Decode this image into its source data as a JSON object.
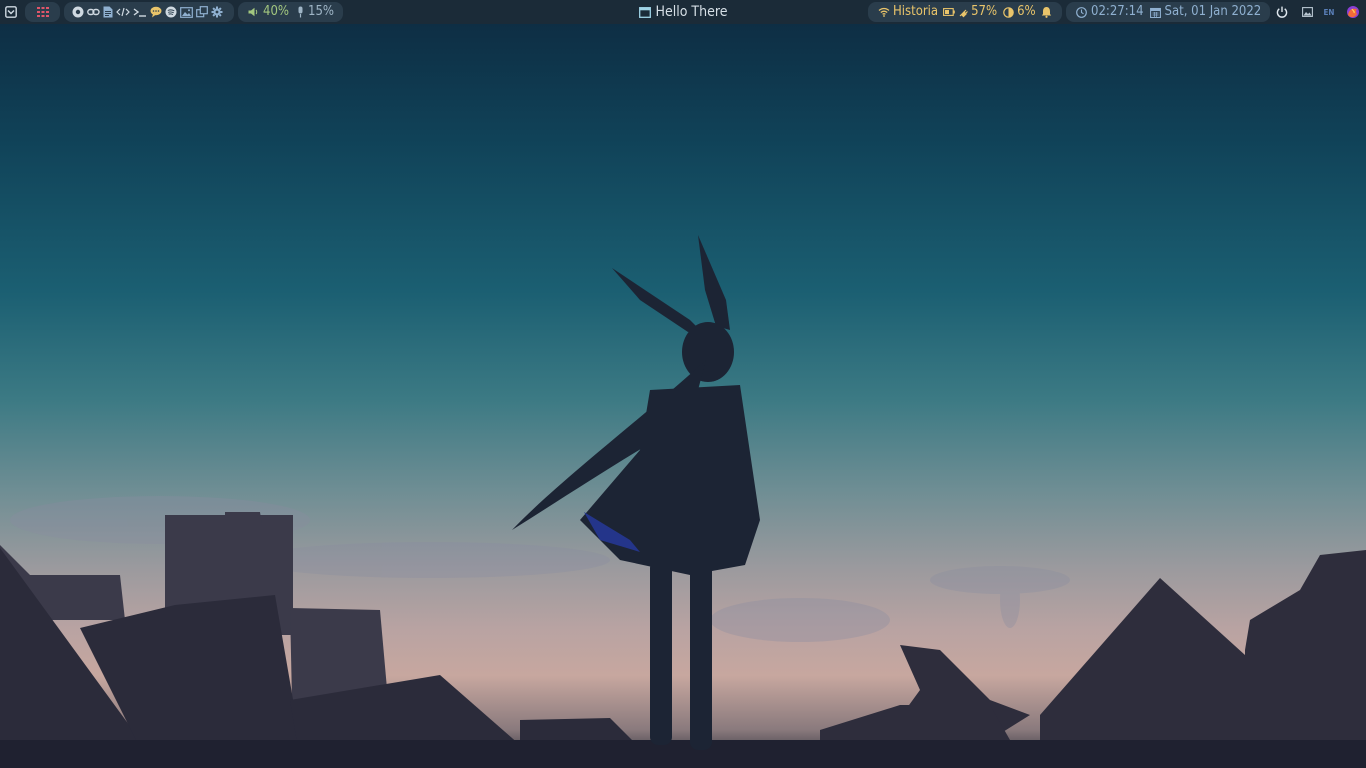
{
  "colors": {
    "bar_bg": "#1b2b38",
    "pill_bg": "#2a3d4c",
    "text": "#9fb5c6",
    "accent_red": "#e0566a",
    "accent_yellow": "#e9c46a",
    "accent_cyan": "#7fb8d4"
  },
  "topbar": {
    "menu_icon": "dropdown-box-icon",
    "apps_icon": "grid-icon",
    "launchers": [
      {
        "icon": "chrome-icon"
      },
      {
        "icon": "link-icon"
      },
      {
        "icon": "document-icon"
      },
      {
        "icon": "code-icon"
      },
      {
        "icon": "terminal-icon"
      },
      {
        "icon": "chat-icon"
      },
      {
        "icon": "spotify-icon"
      },
      {
        "icon": "image-icon"
      },
      {
        "icon": "windows-icon"
      },
      {
        "icon": "settings-icon"
      }
    ],
    "audio": {
      "volume": "40%",
      "mic": "15%"
    },
    "window_title": "Hello There",
    "status": {
      "wifi_name": "Historia",
      "battery": "57%",
      "brightness": "6%"
    },
    "clock": {
      "time": "02:27:14",
      "date": "Sat, 01 Jan 2022"
    },
    "keyboard_layout": "EN"
  }
}
